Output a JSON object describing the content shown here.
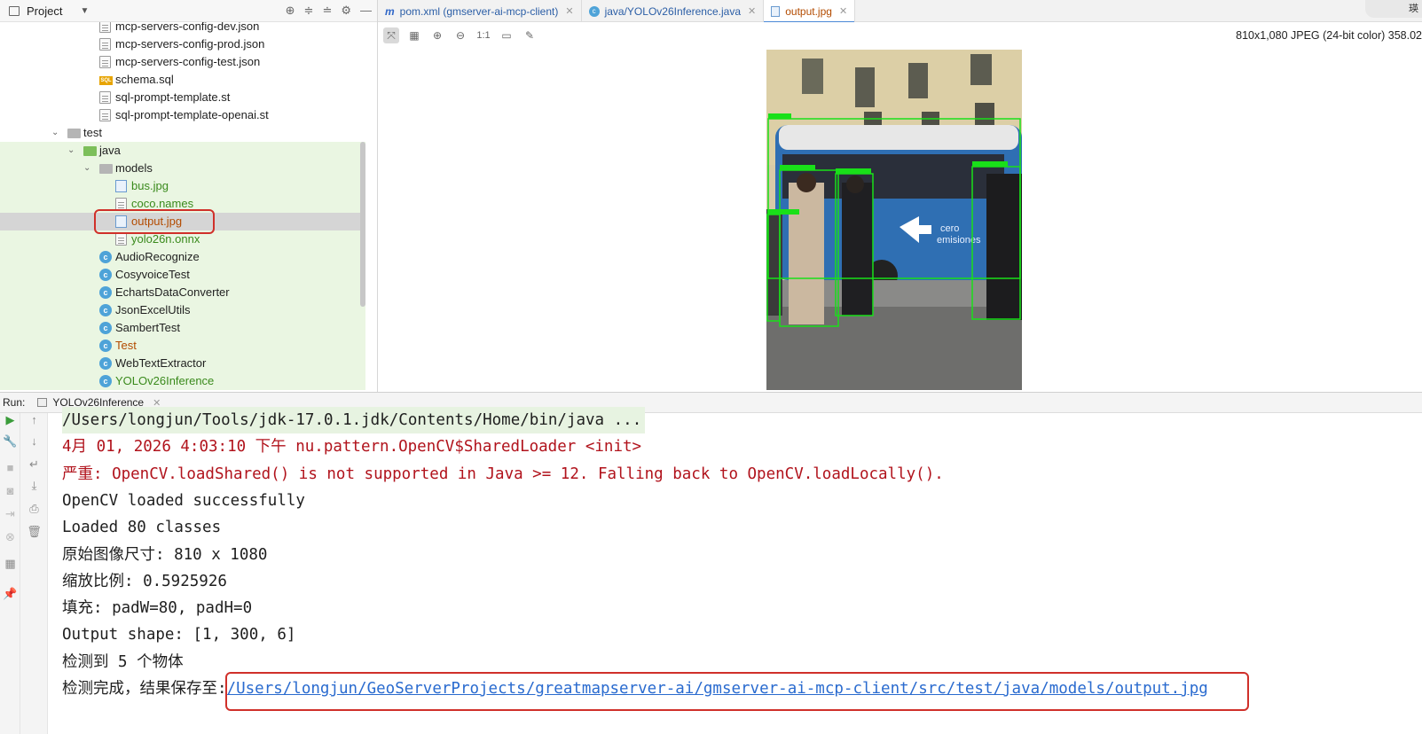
{
  "project": {
    "title": "Project",
    "tree": [
      {
        "label": "mcp-servers-config-dev.json",
        "icon": "json-file-icon",
        "color": "normal"
      },
      {
        "label": "mcp-servers-config-prod.json",
        "icon": "json-file-icon",
        "color": "normal"
      },
      {
        "label": "mcp-servers-config-test.json",
        "icon": "json-file-icon",
        "color": "normal"
      },
      {
        "label": "schema.sql",
        "icon": "sql-file-icon",
        "color": "normal"
      },
      {
        "label": "sql-prompt-template.st",
        "icon": "text-file-icon",
        "color": "normal"
      },
      {
        "label": "sql-prompt-template-openai.st",
        "icon": "text-file-icon",
        "color": "normal"
      },
      {
        "label": "test",
        "icon": "folder-icon",
        "color": "normal"
      },
      {
        "label": "java",
        "icon": "test-folder-icon",
        "color": "normal"
      },
      {
        "label": "models",
        "icon": "folder-icon",
        "color": "normal"
      },
      {
        "label": "bus.jpg",
        "icon": "image-file-icon",
        "color": "green"
      },
      {
        "label": "coco.names",
        "icon": "text-file-icon",
        "color": "green"
      },
      {
        "label": "output.jpg",
        "icon": "image-file-icon",
        "color": "orange"
      },
      {
        "label": "yolo26n.onnx",
        "icon": "file-icon",
        "color": "green"
      },
      {
        "label": "AudioRecognize",
        "icon": "class-icon",
        "color": "normal"
      },
      {
        "label": "CosyvoiceTest",
        "icon": "class-icon",
        "color": "normal"
      },
      {
        "label": "EchartsDataConverter",
        "icon": "class-icon",
        "color": "normal"
      },
      {
        "label": "JsonExcelUtils",
        "icon": "class-icon",
        "color": "normal"
      },
      {
        "label": "SambertTest",
        "icon": "class-icon",
        "color": "normal"
      },
      {
        "label": "Test",
        "icon": "class-icon",
        "color": "orange"
      },
      {
        "label": "WebTextExtractor",
        "icon": "class-icon",
        "color": "normal"
      },
      {
        "label": "YOLOv26Inference",
        "icon": "class-icon",
        "color": "green"
      }
    ]
  },
  "tabs": [
    {
      "label": "pom.xml (gmserver-ai-mcp-client)",
      "icon": "maven-icon",
      "active": false
    },
    {
      "label": "java/YOLOv26Inference.java",
      "icon": "class-icon",
      "active": false
    },
    {
      "label": "output.jpg",
      "icon": "image-file-icon",
      "active": true
    }
  ],
  "viewer": {
    "zoom_label": "1:1",
    "info": "810x1,080 JPEG (24-bit color) 358.02",
    "corner_text": "瑛"
  },
  "run": {
    "label": "Run:",
    "tab": "YOLOv26Inference",
    "lines": [
      {
        "text": "/Users/longjun/Tools/jdk-17.0.1.jdk/Contents/Home/bin/java ...",
        "kind": "cmd"
      },
      {
        "text": "4月 01, 2026 4:03:10 下午 nu.pattern.OpenCV$SharedLoader <init>",
        "kind": "err"
      },
      {
        "text": "严重: OpenCV.loadShared() is not supported in Java >= 12. Falling back to OpenCV.loadLocally().",
        "kind": "err"
      },
      {
        "text": "OpenCV loaded successfully",
        "kind": "out"
      },
      {
        "text": "Loaded 80 classes",
        "kind": "out"
      },
      {
        "text": "原始图像尺寸: 810 x 1080",
        "kind": "out"
      },
      {
        "text": "缩放比例: 0.5925926",
        "kind": "out"
      },
      {
        "text": "填充: padW=80, padH=0",
        "kind": "out"
      },
      {
        "text": "Output shape: [1, 300, 6]",
        "kind": "out"
      },
      {
        "text": "检测到 5 个物体",
        "kind": "out"
      }
    ],
    "final_prefix": "检测完成，结果保存至:",
    "final_link": "/Users/longjun/GeoServerProjects/greatmapserver-ai/gmserver-ai-mcp-client/src/test/java/models/output.jpg"
  },
  "colors": {
    "annotation": "#d0302a",
    "link": "#2a6bcf",
    "error": "#b1131c",
    "detect_box": "#19e019"
  }
}
